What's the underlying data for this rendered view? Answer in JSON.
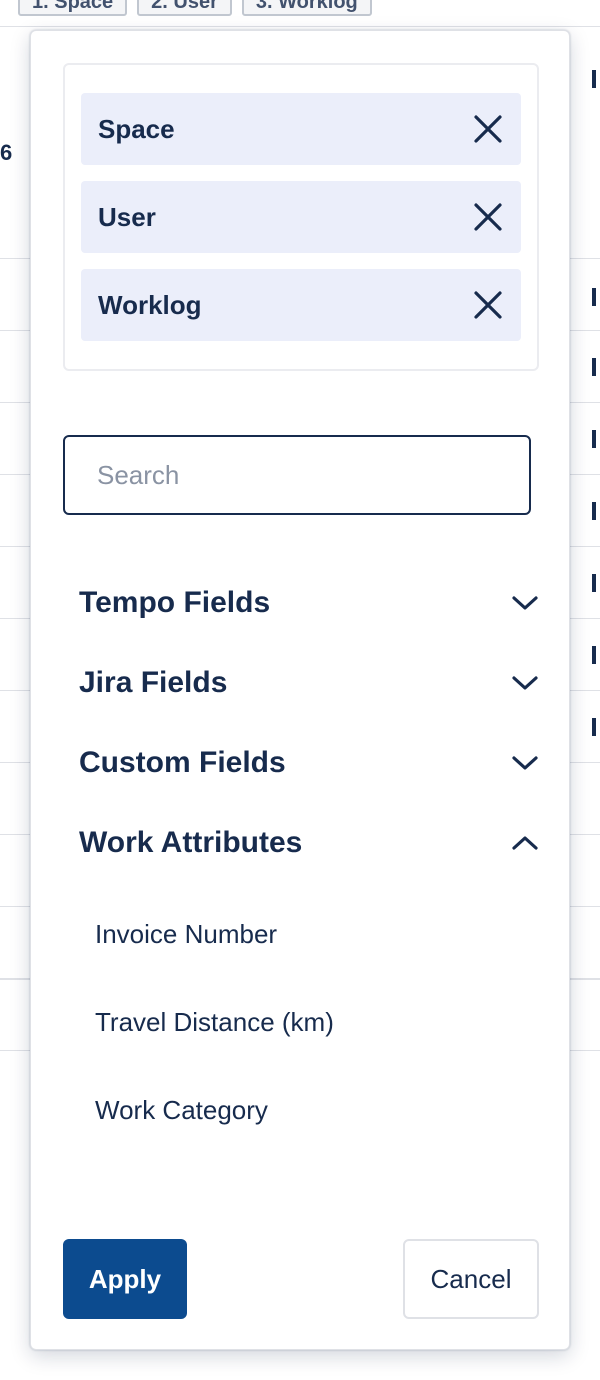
{
  "background": {
    "tabs": [
      "1. Space",
      "2. User",
      "3. Worklog"
    ],
    "row_value": "6"
  },
  "selected_fields": [
    {
      "label": "Space",
      "icon": "close-icon"
    },
    {
      "label": "User",
      "icon": "close-icon"
    },
    {
      "label": "Worklog",
      "icon": "close-icon"
    }
  ],
  "search": {
    "placeholder": "Search",
    "value": ""
  },
  "sections": [
    {
      "label": "Tempo Fields",
      "expanded": false,
      "icon": "chevron-down-icon"
    },
    {
      "label": "Jira Fields",
      "expanded": false,
      "icon": "chevron-down-icon"
    },
    {
      "label": "Custom Fields",
      "expanded": false,
      "icon": "chevron-down-icon"
    },
    {
      "label": "Work Attributes",
      "expanded": true,
      "icon": "chevron-up-icon"
    }
  ],
  "work_attributes": [
    "Invoice Number",
    "Travel Distance (km)",
    "Work Category"
  ],
  "actions": {
    "apply_label": "Apply",
    "cancel_label": "Cancel"
  },
  "colors": {
    "primary": "#0c4b8f",
    "text": "#172b4d",
    "chip_bg": "#ebeefa",
    "border": "#dfe1e6"
  }
}
